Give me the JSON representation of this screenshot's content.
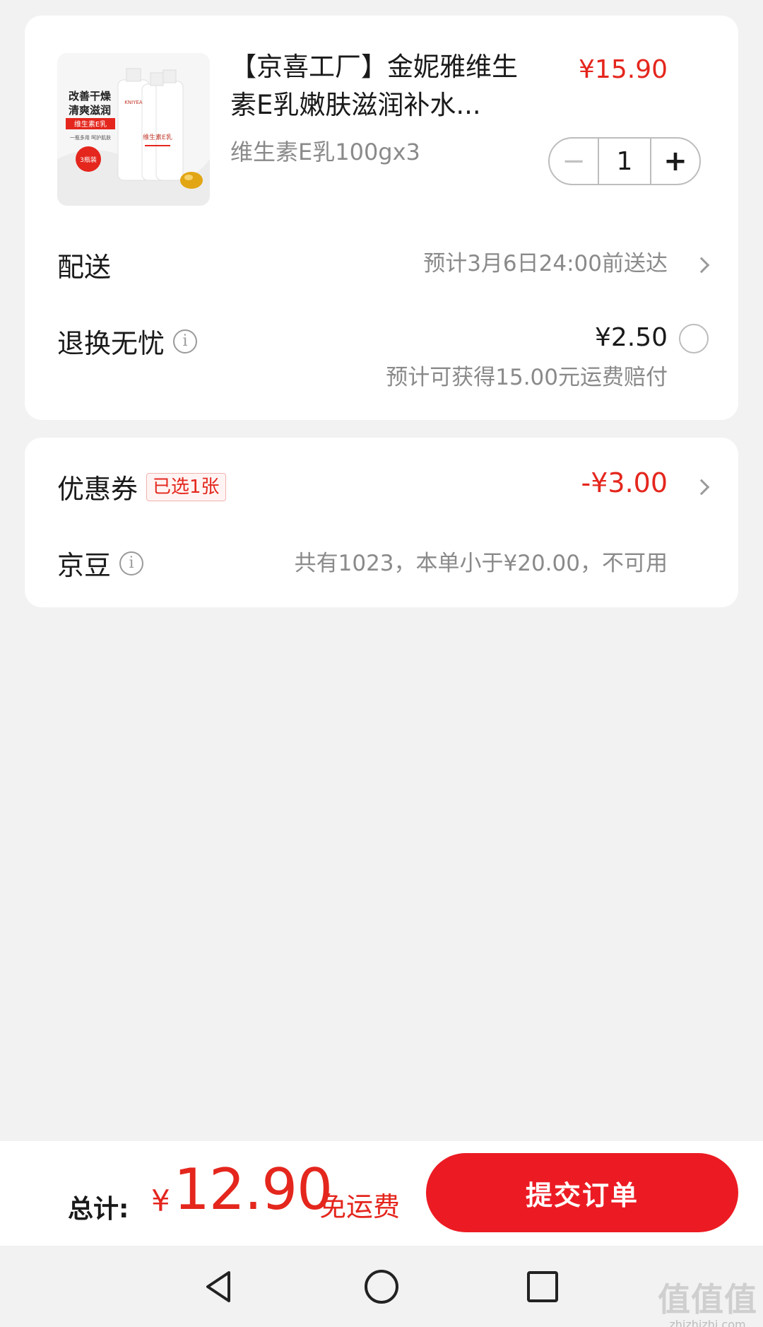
{
  "product": {
    "title": "【京喜工厂】金妮雅维生素E乳嫩肤滋润补水...",
    "price": "¥15.90",
    "spec": "维生素E乳100gx3",
    "quantity": "1",
    "minus_symbol": "−",
    "plus_symbol": "+",
    "image_text": {
      "line1": "改善干燥",
      "line2": "清爽滋润",
      "tag": "维生素E乳",
      "sub": "一瓶多用 呵护肌肤",
      "badge": "3瓶装",
      "bottle_brand": "KNIYEA",
      "bottle_name": "维生素E乳"
    }
  },
  "delivery": {
    "label": "配送",
    "value": "预计3月6日24:00前送达"
  },
  "insurance": {
    "label": "退换无忧",
    "price": "¥2.50",
    "note": "预计可获得15.00元运费赔付"
  },
  "coupon": {
    "label": "优惠券",
    "badge": "已选1张",
    "value": "-¥3.00"
  },
  "beans": {
    "label": "京豆",
    "value": "共有1023，本单小于¥20.00，不可用"
  },
  "footer": {
    "total_label": "总计:",
    "currency": "¥",
    "total": "12.90",
    "free_shipping": "免运费",
    "submit": "提交订单"
  },
  "watermark": {
    "main": "值值值",
    "sub": "zhizhizhi.com"
  },
  "colors": {
    "accent": "#e4261d",
    "submit_bg": "#ec1b23",
    "page_bg": "#f2f2f2"
  },
  "icons": [
    "info-icon",
    "chevron-right-icon",
    "radio-unchecked-icon",
    "back-icon",
    "home-icon",
    "recents-icon"
  ]
}
